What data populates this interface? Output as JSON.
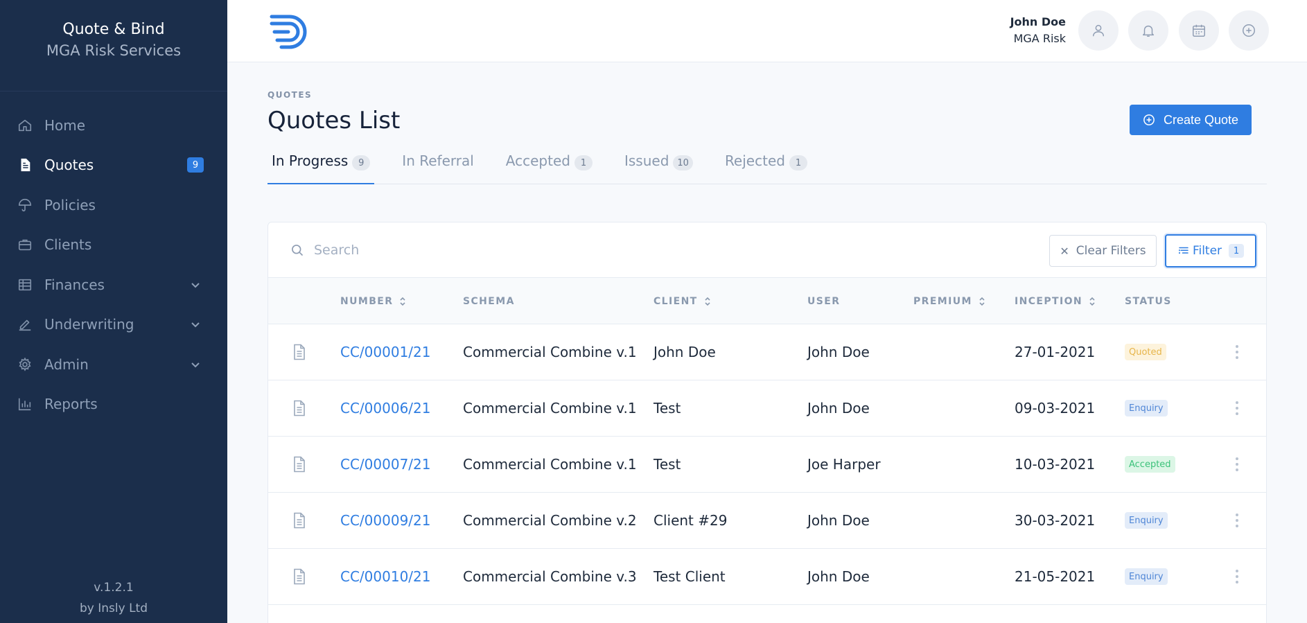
{
  "sidebar": {
    "brand_title": "Quote & Bind",
    "brand_subtitle": "MGA Risk Services",
    "items": [
      {
        "label": "Home",
        "icon": "home-icon"
      },
      {
        "label": "Quotes",
        "icon": "document-icon",
        "badge": "9",
        "active": true
      },
      {
        "label": "Policies",
        "icon": "umbrella-icon"
      },
      {
        "label": "Clients",
        "icon": "briefcase-icon"
      },
      {
        "label": "Finances",
        "icon": "ledger-icon",
        "expandable": true
      },
      {
        "label": "Underwriting",
        "icon": "pencil-icon",
        "expandable": true
      },
      {
        "label": "Admin",
        "icon": "gear-icon",
        "expandable": true
      },
      {
        "label": "Reports",
        "icon": "bar-chart-icon"
      }
    ],
    "version": "v.1.2.1",
    "credit": "by Insly Ltd"
  },
  "header": {
    "user_name": "John Doe",
    "user_org": "MGA Risk"
  },
  "page": {
    "breadcrumb": "QUOTES",
    "title": "Quotes List",
    "create_label": "Create Quote"
  },
  "tabs": [
    {
      "label": "In Progress",
      "count": "9"
    },
    {
      "label": "In Referral",
      "count": ""
    },
    {
      "label": "Accepted",
      "count": "1"
    },
    {
      "label": "Issued",
      "count": "10"
    },
    {
      "label": "Rejected",
      "count": "1"
    }
  ],
  "toolbar": {
    "search_placeholder": "Search",
    "clear_label": "Clear Filters",
    "filter_label": "Filter",
    "filter_count": "1"
  },
  "table": {
    "columns": [
      "NUMBER",
      "SCHEMA",
      "CLIENT",
      "USER",
      "PREMIUM",
      "INCEPTION",
      "STATUS"
    ],
    "rows": [
      {
        "number": "CC/00001/21",
        "schema": "Commercial Combine v.1",
        "client": "John Doe",
        "user": "John Doe",
        "premium": "",
        "inception": "27-01-2021",
        "status": "Quoted"
      },
      {
        "number": "CC/00006/21",
        "schema": "Commercial Combine v.1",
        "client": "Test",
        "user": "John Doe",
        "premium": "",
        "inception": "09-03-2021",
        "status": "Enquiry"
      },
      {
        "number": "CC/00007/21",
        "schema": "Commercial Combine v.1",
        "client": "Test",
        "user": "Joe Harper",
        "premium": "",
        "inception": "10-03-2021",
        "status": "Accepted"
      },
      {
        "number": "CC/00009/21",
        "schema": "Commercial Combine v.2",
        "client": "Client #29",
        "user": "John Doe",
        "premium": "",
        "inception": "30-03-2021",
        "status": "Enquiry"
      },
      {
        "number": "CC/00010/21",
        "schema": "Commercial Combine v.3",
        "client": "Test Client",
        "user": "John Doe",
        "premium": "",
        "inception": "21-05-2021",
        "status": "Enquiry"
      }
    ]
  },
  "colors": {
    "sidebar_bg": "#1b2e4b",
    "accent": "#2f7de1",
    "status_quoted_bg": "#fdf3dc",
    "status_quoted_fg": "#e7b54a",
    "status_enquiry_bg": "#e3ecf9",
    "status_enquiry_fg": "#4f86d6",
    "status_accepted_bg": "#dcf6e6",
    "status_accepted_fg": "#3cc27a"
  }
}
